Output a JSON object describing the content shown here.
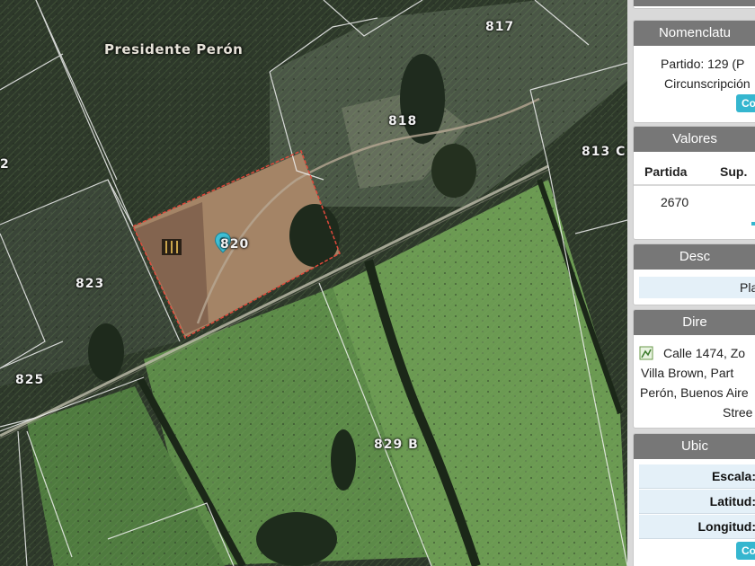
{
  "map": {
    "place_label": "Presidente Perón",
    "parcels": [
      "817",
      "818",
      "813 C",
      "820",
      "823",
      "825",
      "829 B",
      "2"
    ],
    "marker_icon": "map-pin-icon",
    "selection_color": "#e0493b"
  },
  "panel": {
    "nomenclatura": {
      "title": "Nomenclatu",
      "line1": "Partido: 129 (P",
      "line2": "Circunscripción",
      "button": "Co"
    },
    "valores": {
      "title": "Valores",
      "col_partida": "Partida",
      "col_sup": "Sup.",
      "partida_value": "2670"
    },
    "descripcion": {
      "title": "Desc",
      "value": "Pla"
    },
    "direccion": {
      "title": "Dire",
      "lines": [
        "Calle 1474, Zo",
        "Villa Brown, Part",
        "Perón, Buenos Aire",
        "Stree"
      ],
      "icon": "map-icon"
    },
    "ubicacion": {
      "title": "Ubic",
      "escala": "Escala:",
      "latitud": "Latitud:",
      "longitud": "Longitud:",
      "button": "Co"
    }
  }
}
